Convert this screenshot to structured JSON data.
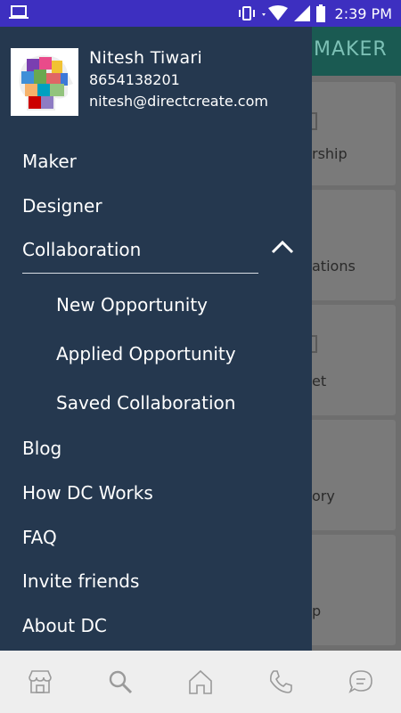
{
  "status_bar": {
    "time": "2:39 PM",
    "icons": [
      "laptop-icon",
      "vibrate-icon",
      "wifi-icon",
      "signal-icon",
      "battery-icon"
    ]
  },
  "background_app": {
    "header_title": "MAKER",
    "cards": [
      {
        "label": "rship"
      },
      {
        "label": "ations"
      },
      {
        "label": "et"
      },
      {
        "label": "ory"
      },
      {
        "label": "p"
      }
    ]
  },
  "drawer": {
    "profile": {
      "name": "Nitesh Tiwari",
      "phone": "8654138201",
      "email": "nitesh@directcreate.com"
    },
    "menu": {
      "maker": "Maker",
      "designer": "Designer",
      "collaboration": "Collaboration",
      "collaboration_sub": [
        "New Opportunity",
        "Applied Opportunity",
        "Saved Collaboration"
      ],
      "blog": "Blog",
      "how_dc_works": "How DC Works",
      "faq": "FAQ",
      "invite_friends": "Invite friends",
      "about_dc": "About DC"
    }
  },
  "bottom_nav": {
    "items": [
      "store-icon",
      "search-icon",
      "home-icon",
      "phone-icon",
      "chat-icon"
    ]
  },
  "colors": {
    "status_bar": "#3d2fc0",
    "drawer_bg": "#25384f",
    "bottom_nav_bg": "#eeeeee",
    "nav_icon": "#9a9a9a"
  }
}
